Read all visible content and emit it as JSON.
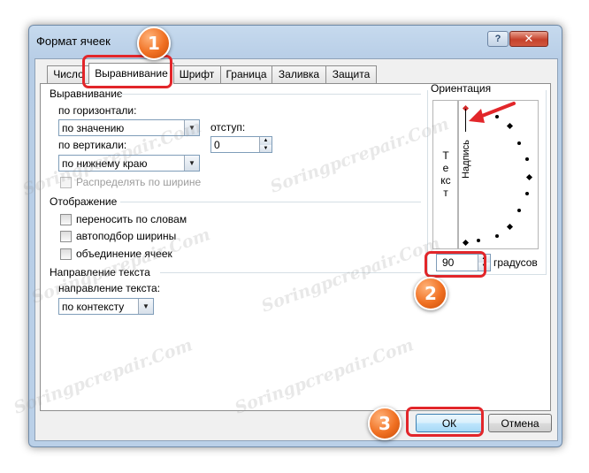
{
  "window": {
    "title": "Формат ячеек",
    "help_label": "?",
    "close_label": "✕"
  },
  "tabs": [
    {
      "label": "Число",
      "active": false
    },
    {
      "label": "Выравнивание",
      "active": true
    },
    {
      "label": "Шрифт",
      "active": false
    },
    {
      "label": "Граница",
      "active": false
    },
    {
      "label": "Заливка",
      "active": false
    },
    {
      "label": "Защита",
      "active": false
    }
  ],
  "alignment": {
    "group_title": "Выравнивание",
    "horizontal_label": "по горизонтали:",
    "horizontal_value": "по значению",
    "indent_label": "отступ:",
    "indent_value": "0",
    "vertical_label": "по вертикали:",
    "vertical_value": "по нижнему краю",
    "distribute_label": "Распределять по ширине"
  },
  "display": {
    "group_title": "Отображение",
    "wrap_label": "переносить по словам",
    "shrink_label": "автоподбор ширины",
    "merge_label": "объединение ячеек"
  },
  "direction": {
    "group_title": "Направление текста",
    "label": "направление текста:",
    "value": "по контексту"
  },
  "orientation": {
    "group_title": "Ориентация",
    "vertical_text": "Текст",
    "rotated_text": "Надпись",
    "degrees_value": "90",
    "degrees_label": "градусов"
  },
  "footer": {
    "ok_label": "ОК",
    "cancel_label": "Отмена"
  },
  "callouts": [
    "1",
    "2",
    "3"
  ],
  "watermark": "Soringpcrepair.Com",
  "colors": {
    "callout": "#f07022",
    "highlight": "#e2262a",
    "arrow": "#e2262a"
  }
}
